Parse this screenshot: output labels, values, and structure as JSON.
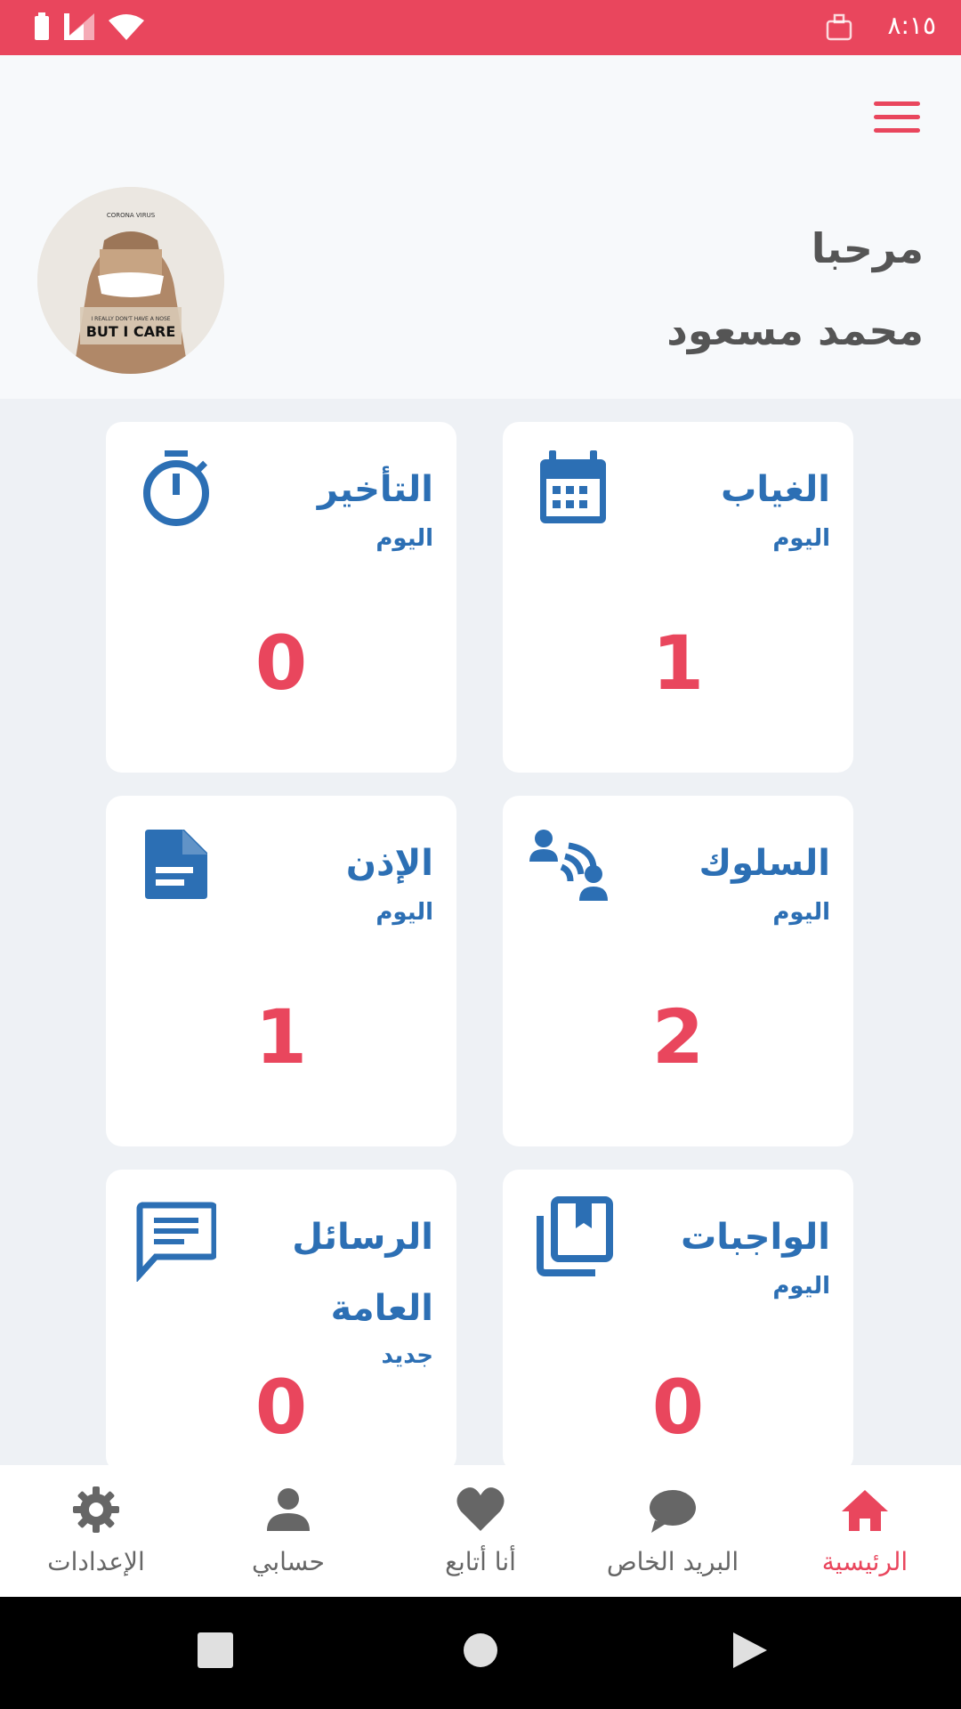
{
  "status_bar": {
    "time": "٨:١٥",
    "icons": [
      "battery-icon",
      "signal-icon",
      "wifi-icon",
      "app-notification-icon"
    ]
  },
  "header": {
    "greeting": "مرحبا",
    "username": "محمد مسعود",
    "avatar_texts": {
      "top": "CORONA VIRUS",
      "bottom": "BUT I CARE",
      "small": "I REALLY DON'T HAVE A NOSE"
    }
  },
  "cards": {
    "absence": {
      "title": "الغياب",
      "sub": "اليوم",
      "value": "1",
      "icon": "calendar-icon"
    },
    "lateness": {
      "title": "التأخير",
      "sub": "اليوم",
      "value": "0",
      "icon": "stopwatch-icon"
    },
    "behavior": {
      "title": "السلوك",
      "sub": "اليوم",
      "value": "2",
      "icon": "behavior-icon"
    },
    "permission": {
      "title": "الإذن",
      "sub": "اليوم",
      "value": "1",
      "icon": "document-icon"
    },
    "homework": {
      "title": "الواجبات",
      "sub": "اليوم",
      "value": "0",
      "icon": "book-icon"
    },
    "messages": {
      "title_line1": "الرسائل",
      "title_line2": "العامة",
      "sub": "جديد",
      "value": "0",
      "icon": "message-icon"
    }
  },
  "bottom_nav": {
    "home": "الرئيسية",
    "mail": "البريد الخاص",
    "follow": "أنا أتابع",
    "account": "حسابي",
    "settings": "الإعدادات"
  },
  "colors": {
    "accent": "#e9465d",
    "primary": "#2c6fb4",
    "muted": "#666666"
  }
}
